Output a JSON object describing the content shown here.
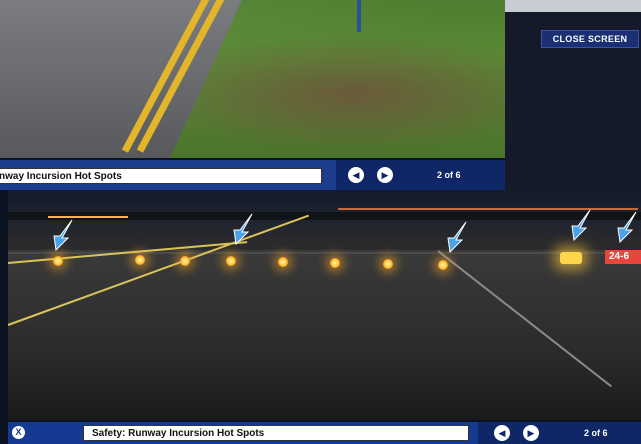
{
  "back_window": {
    "close_button_label": "CLOSE SCREEN",
    "caption": "nway Incursion Hot Spots",
    "prev_glyph": "◀",
    "next_glyph": "▶",
    "page_indicator": "2 of 6",
    "icons": [
      "prev-arrow-icon",
      "next-arrow-icon"
    ]
  },
  "front_window": {
    "close_glyph": "X",
    "caption": "Safety: Runway Incursion Hot Spots",
    "prev_glyph": "◀",
    "next_glyph": "▶",
    "page_indicator": "2 of 6",
    "runway_sign_text": "24-6",
    "icons": [
      "close-icon",
      "prev-arrow-icon",
      "next-arrow-icon",
      "pointer-arrow-icon"
    ]
  },
  "colors": {
    "caption_bar": "#143a92",
    "nav_bar": "#0f2766",
    "arrow": "#4aa3e8",
    "stop_light": "#ffb020",
    "runway_sign": "#e8463c",
    "taxiway_line": "#e2b52b"
  }
}
